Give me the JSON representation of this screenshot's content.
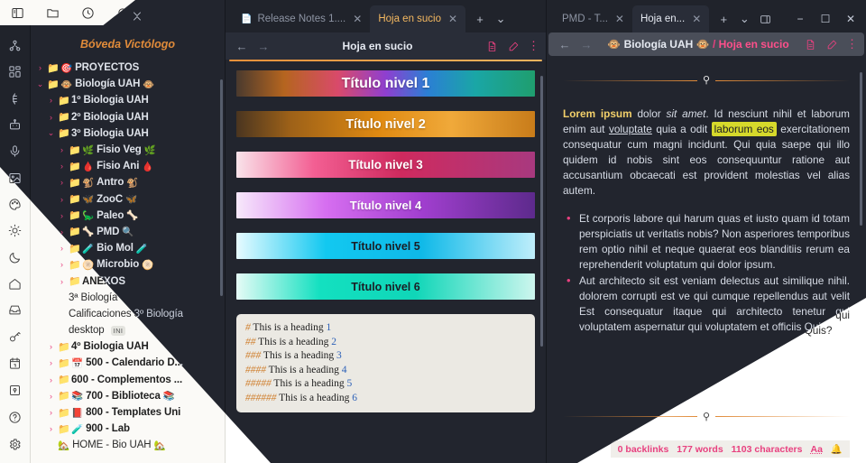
{
  "app": {
    "vault_title": "Bóveda Victólogo",
    "top_icons": [
      "sidebar-toggle-icon",
      "folder-icon",
      "clock-icon",
      "search-icon",
      "list-icon"
    ],
    "ribbon_icons": [
      "graph-icon",
      "canvas-icon",
      "sync-icon",
      "robot-icon",
      "mic-icon",
      "image-icon",
      "palette-icon",
      "sun-icon",
      "moon-icon",
      "home-icon",
      "inbox-icon",
      "key-icon",
      "calendar-icon"
    ],
    "ribbon_bottom_icons": [
      "vault-switch-icon",
      "help-icon",
      "settings-icon"
    ],
    "sidebar_toolbar_icons": [
      "new-note-icon",
      "new-folder-icon",
      "sort-icon",
      "collapse-icon"
    ]
  },
  "sidebar": {
    "items": [
      {
        "chevron": "›",
        "emoji": "🎯",
        "label": "PROYECTOS",
        "indent": 0,
        "type": "folder",
        "open": false
      },
      {
        "chevron": "⌄",
        "emoji": "🐵",
        "label": "Biología UAH",
        "suffix_emoji": "🐵",
        "indent": 0,
        "type": "folder",
        "open": true
      },
      {
        "chevron": "›",
        "emoji": "",
        "label": "1º Biologia UAH",
        "indent": 1,
        "type": "folder",
        "open": false
      },
      {
        "chevron": "›",
        "emoji": "",
        "label": "2º Biologia UAH",
        "indent": 1,
        "type": "folder",
        "open": false
      },
      {
        "chevron": "⌄",
        "emoji": "",
        "label": "3º Biologia UAH",
        "indent": 1,
        "type": "folder",
        "open": true
      },
      {
        "chevron": "›",
        "emoji": "🌿",
        "label": "Fisio Veg",
        "suffix_emoji": "🌿",
        "indent": 2,
        "type": "folder",
        "open": false
      },
      {
        "chevron": "›",
        "emoji": "🩸",
        "label": "Fisio Ani",
        "suffix_emoji": "🩸",
        "indent": 2,
        "type": "folder",
        "open": false
      },
      {
        "chevron": "›",
        "emoji": "🐒",
        "label": "Antro",
        "suffix_emoji": "🐒",
        "indent": 2,
        "type": "folder",
        "open": false
      },
      {
        "chevron": "›",
        "emoji": "🦋",
        "label": "ZooC",
        "suffix_emoji": "🦋",
        "indent": 2,
        "type": "folder",
        "open": false
      },
      {
        "chevron": "›",
        "emoji": "🦕",
        "label": "Paleo",
        "suffix_emoji": "🦴",
        "indent": 2,
        "type": "folder",
        "open": false
      },
      {
        "chevron": "›",
        "emoji": "🦴",
        "label": "PMD",
        "suffix_emoji": "🔍",
        "indent": 2,
        "type": "folder",
        "open": false
      },
      {
        "chevron": "›",
        "emoji": "🧪",
        "label": "Bio Mol",
        "suffix_emoji": "🧪",
        "indent": 2,
        "type": "folder",
        "open": false
      },
      {
        "chevron": "›",
        "emoji": "🫓",
        "label": "Microbio",
        "suffix_emoji": "🫓",
        "indent": 2,
        "type": "folder",
        "open": false
      },
      {
        "chevron": "›",
        "emoji": "",
        "label": "ANEXOS",
        "indent": 2,
        "type": "folder",
        "open": false
      },
      {
        "chevron": "",
        "emoji": "",
        "label": "3ª Biología",
        "indent": 2,
        "type": "file"
      },
      {
        "chevron": "",
        "emoji": "",
        "label": "Calificaciones 3º Biología",
        "indent": 2,
        "type": "file"
      },
      {
        "chevron": "",
        "emoji": "",
        "label": "desktop",
        "badge": "INI",
        "indent": 2,
        "type": "file"
      },
      {
        "chevron": "›",
        "emoji": "",
        "label": "4º Biologia UAH",
        "indent": 1,
        "type": "folder",
        "open": false
      },
      {
        "chevron": "›",
        "emoji": "📅",
        "label": "500 - ",
        "label2": "Calendario D...",
        "indent": 1,
        "type": "folder",
        "open": false
      },
      {
        "chevron": "›",
        "emoji": "",
        "label": "600 - Complementos ...",
        "indent": 1,
        "type": "folder",
        "open": false
      },
      {
        "chevron": "›",
        "emoji": "📚",
        "label": "700 - ",
        "label2": "Biblioteca",
        "suffix_emoji": "📚",
        "indent": 1,
        "type": "folder",
        "open": false
      },
      {
        "chevron": "›",
        "emoji": "📕",
        "label": "800 - ",
        "label2": "Templates Uni",
        "indent": 1,
        "type": "folder",
        "open": false
      },
      {
        "chevron": "›",
        "emoji": "🧪",
        "label": "900 - ",
        "label2": "Lab",
        "indent": 1,
        "type": "folder",
        "open": false
      },
      {
        "chevron": "",
        "emoji": "🏡",
        "label": "HOME - Bio UAH",
        "suffix_emoji": "🏡",
        "indent": 1,
        "type": "file"
      }
    ]
  },
  "mid_pane": {
    "tabs": [
      {
        "label": "Release Notes 1....",
        "active": false,
        "icon": "document-icon"
      },
      {
        "label": "Hoja en sucio",
        "active": true
      }
    ],
    "tab_controls": [
      "new-tab-icon",
      "tab-list-icon"
    ],
    "header": {
      "back": "←",
      "forward": "→",
      "title": "Hoja en sucio",
      "actions": [
        "reading-view-icon",
        "edit-pencil-icon",
        "more-options-icon"
      ]
    },
    "headings": [
      {
        "text": "Título nivel 1",
        "level": 1
      },
      {
        "text": "Título nivel 2",
        "level": 2
      },
      {
        "text": "Título nivel 3",
        "level": 3
      },
      {
        "text": "Título nivel 4",
        "level": 4
      },
      {
        "text": "Título nivel 5",
        "level": 5
      },
      {
        "text": "Título nivel 6",
        "level": 6
      }
    ],
    "code_block": [
      {
        "hash": "#",
        "text": " This is a heading ",
        "num": "1"
      },
      {
        "hash": "##",
        "text": " This is a heading ",
        "num": "2"
      },
      {
        "hash": "###",
        "text": " This is a heading ",
        "num": "3"
      },
      {
        "hash": "####",
        "text": " This is a heading ",
        "num": "4"
      },
      {
        "hash": "#####",
        "text": " This is a heading ",
        "num": "5"
      },
      {
        "hash": "######",
        "text": " This is a heading ",
        "num": "6"
      }
    ]
  },
  "right_pane": {
    "tabs": [
      {
        "label": "PMD - T...",
        "active": false
      },
      {
        "label": "Hoja en...",
        "active": true
      }
    ],
    "tab_controls": [
      "new-tab-icon",
      "tab-list-icon",
      "split-view-icon"
    ],
    "window_controls": [
      "minimize-icon",
      "maximize-icon",
      "close-icon"
    ],
    "header": {
      "back": "←",
      "forward": "→",
      "crumb_emoji_left": "🐵",
      "crumb_root": "Biología UAH",
      "crumb_emoji_right": "🐵",
      "crumb_sep": "/",
      "crumb_active": "Hoja en sucio",
      "actions": [
        "reading-view-icon",
        "edit-pencil-icon",
        "more-options-icon"
      ]
    },
    "paragraph": {
      "bold": "Lorem ipsum",
      "p1a": " dolor ",
      "italic": "sit amet",
      "p1b": ". Id nesciunt nihil et laborum enim aut ",
      "underline": "voluptate",
      "p1c": " quia a odit ",
      "highlight": "laborum eos",
      "p1d": " exercitationem consequatur cum magni incidunt. Qui quia saepe qui illo quidem id nobis sint eos consequuntur ratione aut accusantium obcaecati est provident molestias vel alias autem."
    },
    "bullets": [
      "Et corporis labore qui harum quas et iusto quam id totam perspiciatis ut veritatis nobis? Non asperiores temporibus rem optio nihil et neque quaerat eos blanditiis rerum ea reprehenderit voluptatum qui dolor ipsum.",
      "Aut architecto sit est veniam delectus aut similique nihil. dolorem corrupti est ve qui cumque repellendus aut velit Est consequatur itaque qui architecto tenetur qui voluptatem aspernatur qui voluptatem et officiis Quis?"
    ],
    "status": {
      "backlinks": "0 backlinks",
      "words": "177 words",
      "characters": "1103 characters",
      "font_icon": "Aa",
      "bell_icon": "notification-icon"
    }
  },
  "colors": {
    "accent_pink": "#e8407f",
    "accent_orange": "#e08b3a",
    "highlight": "#d6d92b",
    "bold_yellow": "#f3d06a",
    "dark_bg": "#22252e",
    "light_bg": "#ffffff"
  }
}
